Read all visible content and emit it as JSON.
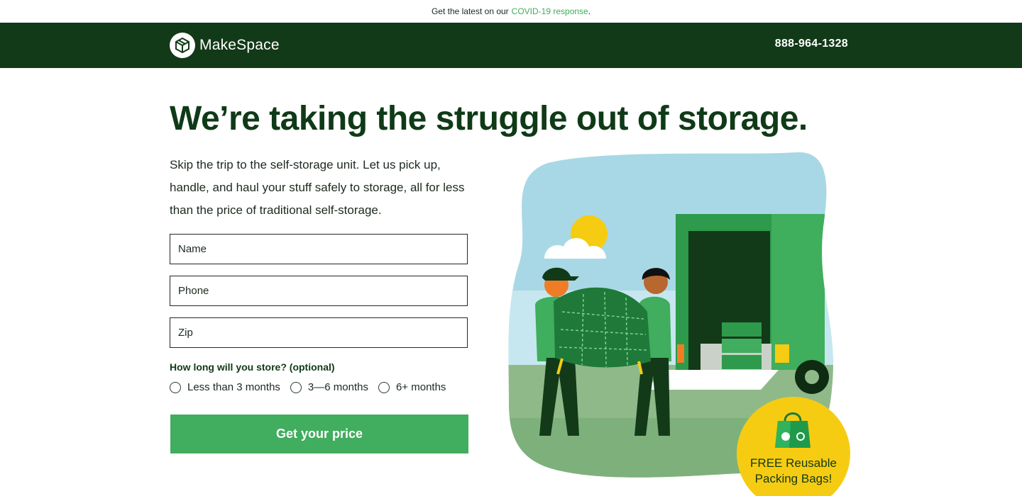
{
  "topbar": {
    "prefix": "Get the latest on our",
    "link": "COVID-19 response",
    "suffix": "."
  },
  "header": {
    "logo_text": "MakeSpace",
    "phone": "888-964-1328"
  },
  "hero": {
    "headline": "We’re taking the struggle out of storage.",
    "intro": "Skip the trip to the self-storage unit. Let us pick up, handle, and haul your stuff safely to storage, all for less than the price of traditional self-storage."
  },
  "form": {
    "name_placeholder": "Name",
    "phone_placeholder": "Phone",
    "zip_placeholder": "Zip",
    "duration_label": "How long will you store? (optional)",
    "options": [
      "Less than 3 months",
      "3—6 months",
      "6+ months"
    ],
    "submit_label": "Get your price"
  },
  "badge": {
    "line1": "FREE Reusable",
    "line2": "Packing Bags!"
  },
  "colors": {
    "brand_dark": "#123a18",
    "brand_green": "#41ad5e",
    "badge_yellow": "#f6cc12"
  }
}
